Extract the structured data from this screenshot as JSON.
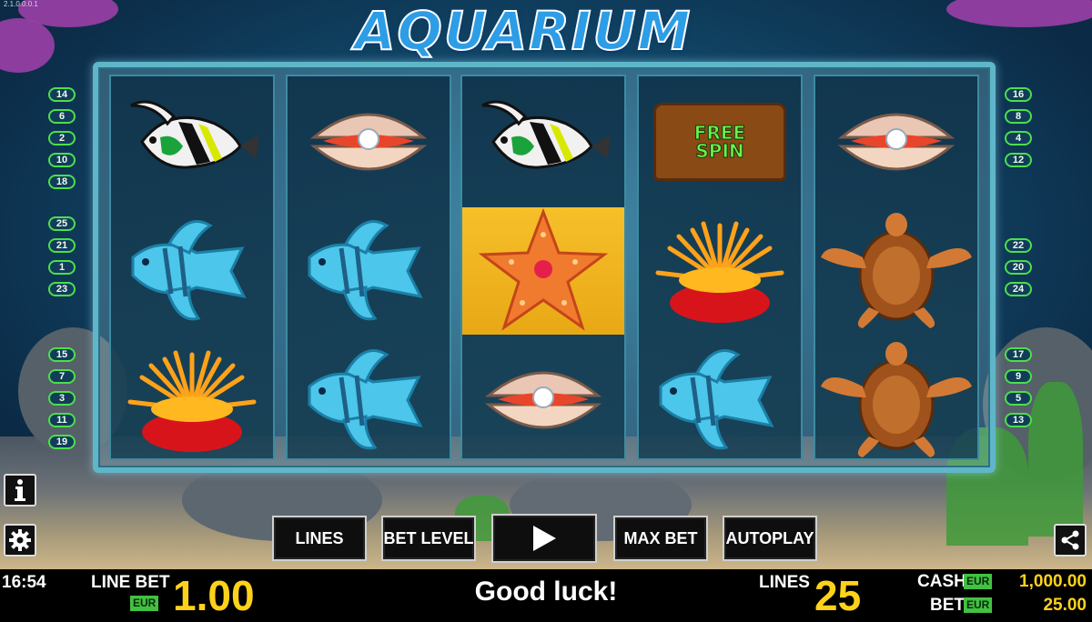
{
  "game": {
    "title": "AQUARIUM",
    "version": "2.1.0.0.0.1"
  },
  "paylines": {
    "left_top": [
      "14",
      "6",
      "2",
      "10",
      "18"
    ],
    "left_mid": [
      "25",
      "21",
      "1",
      "23"
    ],
    "left_bot": [
      "15",
      "7",
      "3",
      "11",
      "19"
    ],
    "right_top": [
      "16",
      "8",
      "4",
      "12"
    ],
    "right_mid": [
      "22",
      "20",
      "24"
    ],
    "right_bot": [
      "17",
      "9",
      "5",
      "13"
    ]
  },
  "reels": [
    [
      "angelfish",
      "blue-fish",
      "anemone"
    ],
    [
      "clam-pearl",
      "blue-fish",
      "blue-fish"
    ],
    [
      "angelfish",
      "starfish",
      "clam-pearl"
    ],
    [
      "free-spin-chest",
      "anemone",
      "blue-fish"
    ],
    [
      "clam-pearl",
      "turtle",
      "turtle"
    ]
  ],
  "highlighted": {
    "reel": 2,
    "row": 1
  },
  "free_spin_text": [
    "FREE",
    "SPIN"
  ],
  "controls": {
    "lines": "LINES",
    "bet_level": "BET LEVEL",
    "spin_icon": "play-icon",
    "max_bet": "MAX BET",
    "autoplay": "AUTOPLAY"
  },
  "side": {
    "info_icon": "info-icon",
    "settings_icon": "gear-icon",
    "share_icon": "share-icon"
  },
  "status_bar": {
    "time": "16:54",
    "line_bet_label": "LINE BET",
    "currency": "EUR",
    "line_bet_value": "1.00",
    "message": "Good luck!",
    "lines_label": "LINES",
    "lines_value": "25",
    "cash_label": "CASH",
    "bet_label": "BET",
    "cash_value": "1,000.00",
    "bet_value": "25.00"
  },
  "colors": {
    "accent_yellow": "#ffd21a",
    "eur_green": "#42c142",
    "payline_green": "#4be04a"
  }
}
